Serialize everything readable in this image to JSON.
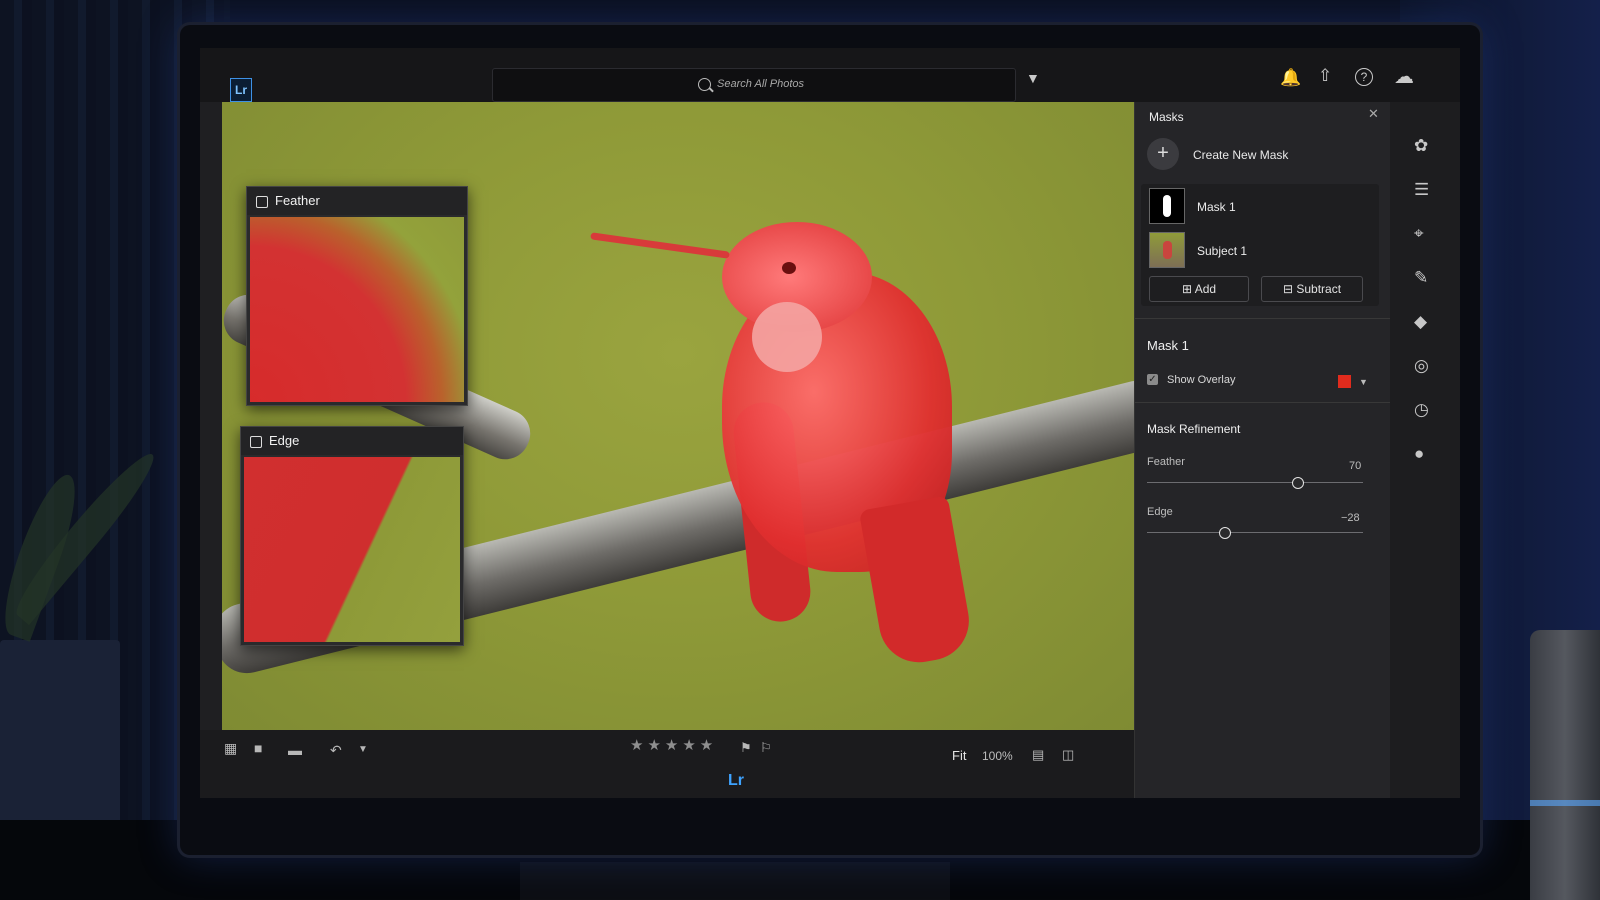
{
  "app": {
    "logo_text": "Lr",
    "bottom_logo": "Lr"
  },
  "search": {
    "placeholder": "Search All Photos"
  },
  "top_icons": [
    "filter-icon",
    "bell-icon",
    "share-icon",
    "help-icon",
    "cloud-icon"
  ],
  "insets": [
    {
      "label": "Feather"
    },
    {
      "label": "Edge"
    }
  ],
  "masks_panel": {
    "title": "Masks",
    "create_label": "Create New Mask",
    "items": [
      {
        "label": "Mask 1"
      },
      {
        "label": "Subject 1"
      }
    ],
    "add_label": "Add",
    "subtract_label": "Subtract"
  },
  "mask_settings": {
    "title": "Mask 1",
    "show_overlay_label": "Show Overlay",
    "show_overlay_checked": true,
    "overlay_color": "#e12b1d",
    "refinement_title": "Mask Refinement",
    "feather_label": "Feather",
    "feather_value": "70",
    "feather_min": 0,
    "feather_max": 100,
    "edge_label": "Edge",
    "edge_value": "−28",
    "edge_min": -100,
    "edge_max": 100
  },
  "bottombar": {
    "stars": "★★★★★",
    "fit_label": "Fit",
    "zoom_label": "100%"
  },
  "tool_strip": [
    "heal-icon",
    "edit-sliders-icon",
    "crop-icon",
    "brush-icon",
    "eraser-icon",
    "mask-circle-icon",
    "history-icon",
    "globe-icon"
  ]
}
